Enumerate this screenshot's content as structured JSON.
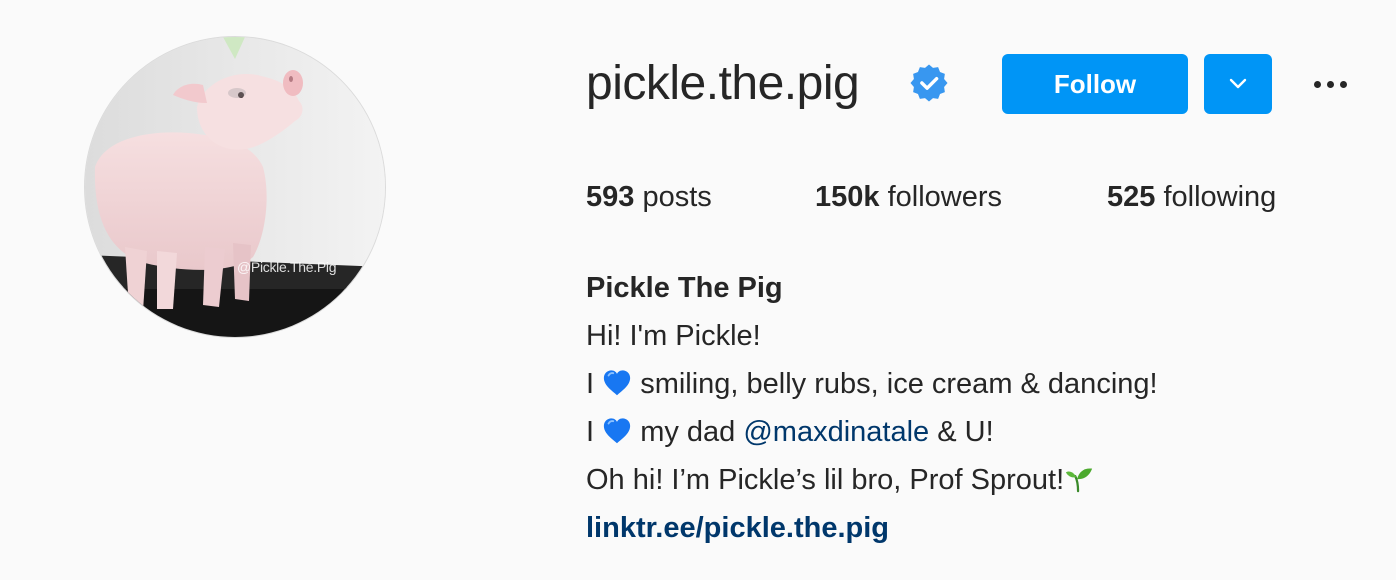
{
  "profile": {
    "username": "pickle.the.pig",
    "verified": true,
    "avatar_watermark": "@Pickle.The.Pig"
  },
  "actions": {
    "follow_label": "Follow",
    "dropdown_icon": "chevron-down-icon",
    "more_icon": "more-horizontal-icon"
  },
  "stats": {
    "posts": {
      "count": "593",
      "label": "posts"
    },
    "followers": {
      "count": "150k",
      "label": "followers"
    },
    "following": {
      "count": "525",
      "label": "following"
    }
  },
  "bio": {
    "name": "Pickle The Pig",
    "line1": "Hi! I'm Pickle!",
    "line2_pre": "I",
    "line2_post": "smiling, belly rubs, ice cream & dancing!",
    "line3_pre": "I",
    "line3_mid": "my dad",
    "line3_mention": "@maxdinatale",
    "line3_post": "& U!",
    "line4": "Oh hi! I’m Pickle’s lil bro, Prof Sprout!",
    "link": "linktr.ee/pickle.the.pig"
  },
  "colors": {
    "accent": "#0095f6",
    "link": "#00376b",
    "verified": "#3897f0",
    "text": "#262626",
    "background": "#fafafa"
  }
}
